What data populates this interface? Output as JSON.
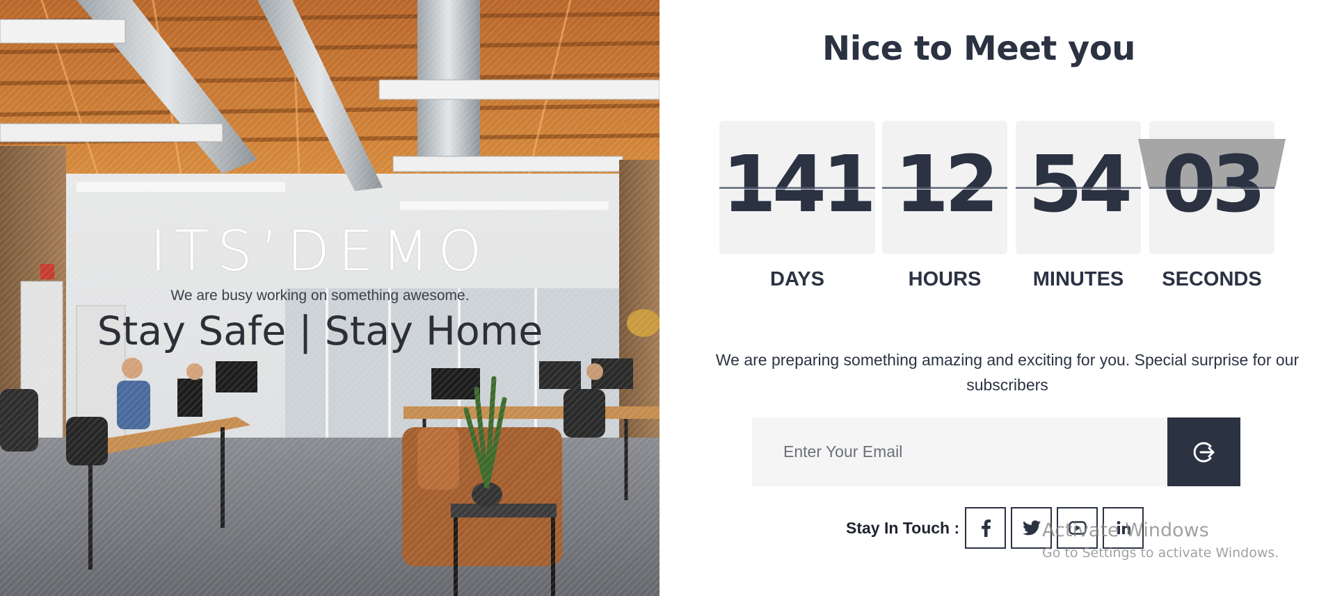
{
  "hero": {
    "logo": "ITS’DEMO",
    "tagline": "We are busy working on something awesome.",
    "headline": "Stay Safe | Stay Home"
  },
  "page": {
    "title": "Nice to Meet you"
  },
  "countdown": [
    {
      "value": "141",
      "label": "DAYS"
    },
    {
      "value": "12",
      "label": "HOURS"
    },
    {
      "value": "54",
      "label": "MINUTES"
    },
    {
      "value": "03",
      "label": "SECONDS"
    }
  ],
  "intro": "We are preparing something amazing and exciting for you. Special surprise for our subscribers",
  "subscribe": {
    "placeholder": "Enter Your Email",
    "submit_icon": "arrow-right-circle-icon"
  },
  "social": {
    "label": "Stay In Touch :",
    "links": [
      {
        "icon": "facebook-icon"
      },
      {
        "icon": "twitter-icon"
      },
      {
        "icon": "youtube-icon"
      },
      {
        "icon": "linkedin-icon"
      }
    ]
  },
  "watermark": {
    "title": "Activate Windows",
    "subtitle": "Go to Settings to activate Windows."
  },
  "colors": {
    "primary": "#2b3242",
    "card_bg": "#f2f2f3",
    "input_bg": "#f5f5f5",
    "flip_flap": "#a6a6a6"
  }
}
